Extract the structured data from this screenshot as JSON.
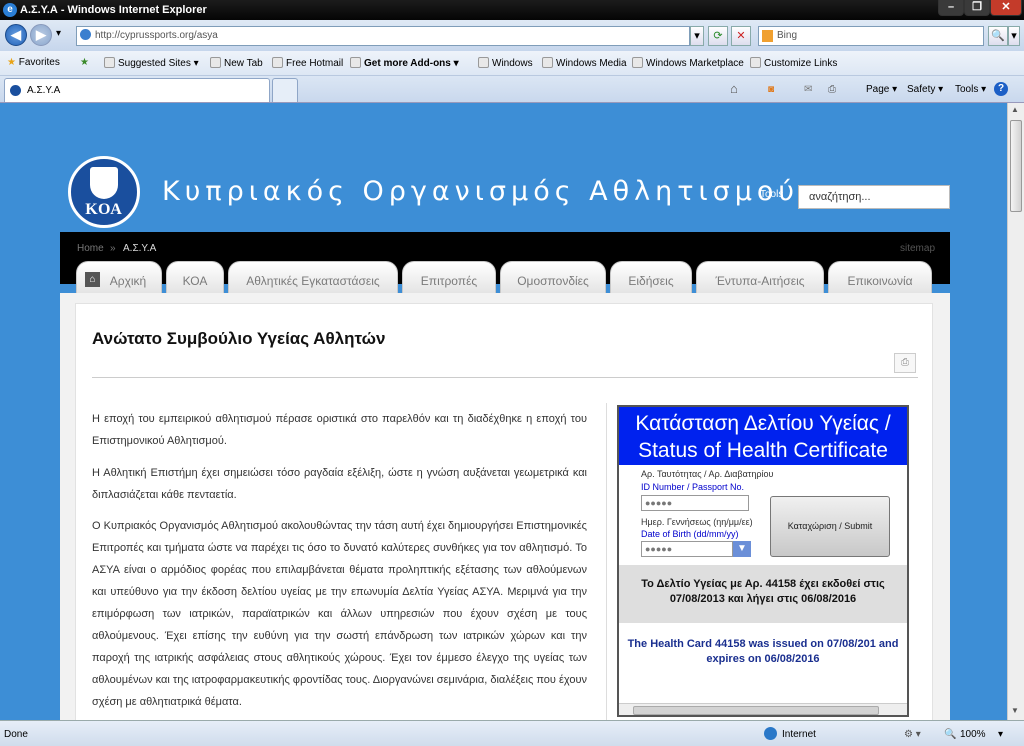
{
  "window": {
    "title": "Α.Σ.Υ.Α - Windows Internet Explorer",
    "min": "–",
    "max": "❐",
    "close": "✕"
  },
  "browser": {
    "back": "◀",
    "forward": "▶",
    "history": "▾",
    "address": "http://cyprussports.org/asya",
    "search_placeholder": "Bing",
    "refresh": "⟳",
    "stop": "✕",
    "search_go": "🔍",
    "favorites": [
      "Favorites",
      "Suggested Sites ▾",
      "New Tab",
      "Free Hotmail",
      "Get more Add-ons ▾",
      "Windows",
      "Windows Media",
      "Windows Marketplace",
      "Customize Links"
    ],
    "tab": "Α.Σ.Υ.Α",
    "commands": [
      "Page ▾",
      "Safety ▾",
      "Tools ▾"
    ],
    "status": "Done",
    "zone": "Internet",
    "zoom": "100%"
  },
  "site": {
    "logo_text": "ΚΟΑ",
    "name": "Κυπριακός Οργανισμός Αθλητισμού",
    "tools_label": "Tools",
    "search_placeholder": "αναζήτηση...",
    "breadcrumb": {
      "home": "Home",
      "sep": "»",
      "current": "Α.Σ.Υ.Α"
    },
    "sitemap": "sitemap",
    "nav": [
      "Αρχική",
      "ΚΟΑ",
      "Αθλητικές Εγκαταστάσεις",
      "Επιτροπές",
      "Ομοσπονδίες",
      "Ειδήσεις",
      "Έντυπα-Αιτήσεις",
      "Επικοινωνία"
    ],
    "heading": "Ανώτατο Συμβούλιο Υγείας Αθλητών",
    "print_icon": "⎙",
    "paragraphs": [
      "Η εποχή του εμπειρικού αθλητισμού πέρασε οριστικά στο παρελθόν και τη διαδέχθηκε η εποχή του Επιστημονικού Αθλητισμού.",
      "Η Αθλητική Επιστήμη έχει σημειώσει τόσο ραγδαία εξέλιξη, ώστε η γνώση αυξάνεται γεωμετρικά και διπλασιάζεται κάθε πενταετία.",
      "Ο Κυπριακός Οργανισμός Αθλητισμού ακολουθώντας την τάση αυτή έχει δημιουργήσει Επιστημονικές Επιτροπές και τμήματα ώστε να παρέχει τις όσο το δυνατό καλύτερες συνθήκες για τον αθλητισμό. Το ΑΣΥΑ είναι ο αρμόδιος φορέας που επιλαμβάνεται θέματα προληπτικής εξέτασης των αθλούμενων και υπεύθυνο για την έκδοση δελτίου υγείας με την επωνυμία Δελτία Υγείας ΑΣΥΑ. Μεριμνά για την επιμόρφωση των ιατρικών, παραϊατρικών και άλλων υπηρεσιών που έχουν σχέση με τους αθλούμενους. Έχει επίσης την ευθύνη για την σωστή επάνδρωση των ιατρικών χώρων και την παροχή της ιατρικής ασφάλειας στους αθλητικούς χώρους. Έχει τον έμμεσο έλεγχο της υγείας των αθλουμένων και της ιατροφαρμακευτικής φροντίδας τους. Διοργανώνει σεμινάρια, διαλέξεις που έχουν σχέση με αθλητιατρικά θέματα."
    ],
    "widget": {
      "title": "Κατάσταση Δελτίου Υγείας / Status of Health Certificate",
      "id_label_gr": "Αρ. Ταυτότητας / Αρ. Διαβατηρίου",
      "id_label_en": "ID Number / Passport No.",
      "id_value": "●●●●●",
      "dob_label_gr": "Ημερ. Γεννήσεως (ηη/μμ/εε)",
      "dob_label_en": "Date of Birth (dd/mm/yy)",
      "dob_value": "●●●●●",
      "submit": "Καταχώριση / Submit",
      "result_gr": "Το Δελτίο Υγείας με Αρ. 44158 έχει εκδοθεί στις 07/08/2013 και λήγει στις 06/08/2016",
      "result_en": "The Health Card 44158 was issued on 07/08/201 and expires on 06/08/2016"
    }
  }
}
